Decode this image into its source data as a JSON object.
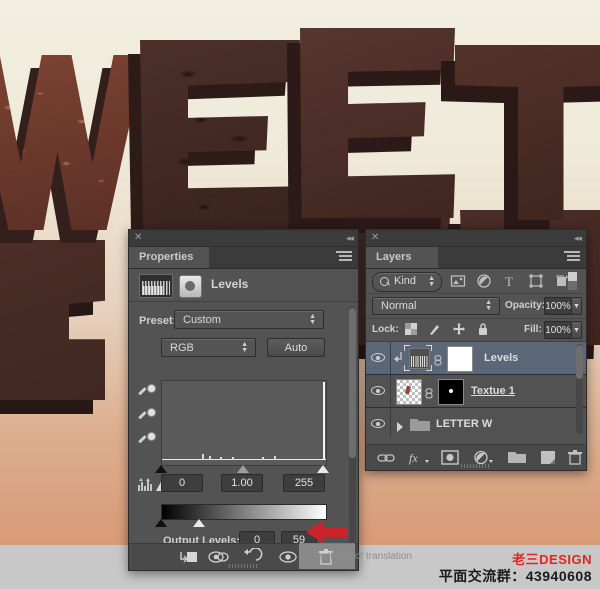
{
  "artwork": {
    "description": "3D chocolate letters on cream-to-peach gradient background",
    "letters": [
      "W",
      "E",
      "E",
      "T"
    ],
    "background_top_color": "#f2efe0",
    "background_bottom_color": "#d79a77",
    "footer_band_color": "#c8c8c8"
  },
  "properties_panel": {
    "tab_label": "Properties",
    "close_icon": "close-icon",
    "collapse_icon": "collapse-icon",
    "menu_icon": "panel-menu-icon",
    "adjustment_title": "Levels",
    "preset_label": "Preset:",
    "preset_value": "Custom",
    "channel_value": "RGB",
    "auto_label": "Auto",
    "input_levels": {
      "black": "0",
      "gamma": "1.00",
      "white": "255"
    },
    "output_levels_label": "Output Levels:",
    "output_levels": {
      "black": "0",
      "white": "59"
    },
    "eyedroppers": [
      "set-black-point-eyedropper",
      "set-gray-point-eyedropper",
      "set-white-point-eyedropper"
    ],
    "footer_icons": [
      "clip-to-layer-icon",
      "toggle-layer-visibility-icon",
      "reset-adjustment-icon",
      "preview-eye-icon",
      "delete-adjustment-icon"
    ]
  },
  "layers_panel": {
    "tab_label": "Layers",
    "close_icon": "close-icon",
    "collapse_icon": "collapse-icon",
    "menu_icon": "panel-menu-icon",
    "filter": {
      "kind_label": "Kind",
      "icons": [
        "filter-pixel-icon",
        "filter-adjustment-icon",
        "filter-type-icon",
        "filter-shape-icon",
        "filter-smartobject-icon",
        "filter-toggle-switch"
      ]
    },
    "blend_mode": "Normal",
    "opacity_label": "Opacity:",
    "opacity_value": "100%",
    "lock_label": "Lock:",
    "lock_icons": [
      "lock-transparent-pixels-icon",
      "lock-image-pixels-icon",
      "lock-position-icon",
      "lock-all-icon"
    ],
    "fill_label": "Fill:",
    "fill_value": "100%",
    "layers": [
      {
        "name": "Levels",
        "type": "adjustment",
        "selected": true,
        "visible": true,
        "clipped": true,
        "linked": true,
        "has_mask": true
      },
      {
        "name": "Textue 1",
        "type": "pixel",
        "selected": false,
        "visible": true,
        "clipped": false,
        "linked": true,
        "has_mask": true
      },
      {
        "name": "LETTER W",
        "type": "group",
        "selected": false,
        "visible": true,
        "clipped": false,
        "linked": false,
        "has_mask": false
      }
    ],
    "footer_icons": [
      "link-layers-icon",
      "layer-style-fx-icon",
      "add-layer-mask-icon",
      "new-adjustment-layer-icon",
      "new-group-icon",
      "new-layer-icon",
      "delete-layer-icon"
    ]
  },
  "annotation": {
    "arrow": "red-left-arrow",
    "arrow_color": "#cc2229"
  },
  "watermark": {
    "overlay_text": "Textbook of translation",
    "brand": "老三DESIGN",
    "brand_color": "#e8231f",
    "qq_group": "平面交流群：43940608"
  }
}
